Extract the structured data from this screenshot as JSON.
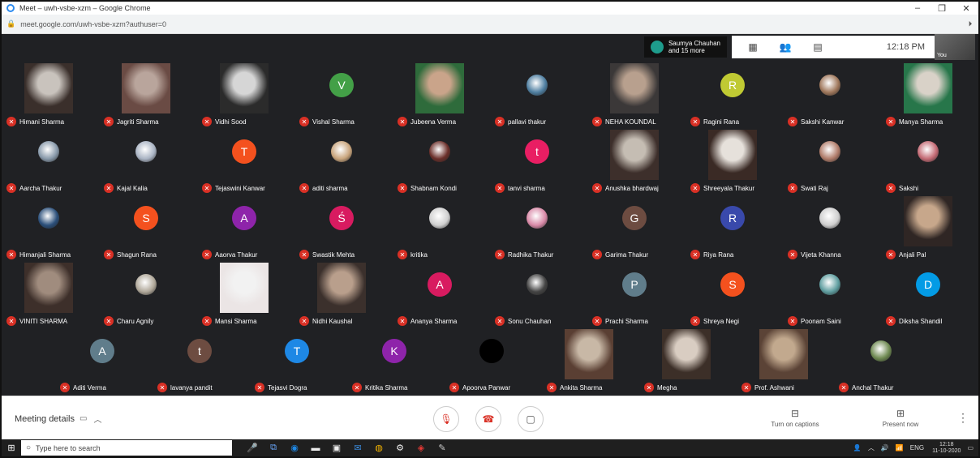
{
  "window": {
    "title": "Meet – uwh-vsbe-xzm – Google Chrome",
    "url": "meet.google.com/uwh-vsbe-xzm?authuser=0"
  },
  "meet": {
    "participants_chip": "Saumya Chauhan\nand 15 more",
    "clock": "12:18 PM",
    "self_label": "You"
  },
  "tiles": [
    [
      {
        "name": "Himani Sharma",
        "kind": "video",
        "colors": [
          "#c9c3bd",
          "#3a2f2b"
        ]
      },
      {
        "name": "Jagriti Sharma",
        "kind": "video",
        "colors": [
          "#b9a59c",
          "#6a4b44"
        ]
      },
      {
        "name": "Vidhi Sood",
        "kind": "video",
        "colors": [
          "#d6d6d6",
          "#2b2b2b"
        ]
      },
      {
        "name": "Vishal Sharma",
        "kind": "avatar",
        "letter": "V",
        "color": "#43a047"
      },
      {
        "name": "Jubeena Verma",
        "kind": "video",
        "colors": [
          "#caa48a",
          "#2e6b3b"
        ]
      },
      {
        "name": "pallavi thakur",
        "kind": "photo",
        "color": "#4f7fa1"
      },
      {
        "name": "NEHA KOUNDAL",
        "kind": "video",
        "colors": [
          "#b8a08e",
          "#3b3838"
        ]
      },
      {
        "name": "Ragini Rana",
        "kind": "avatar",
        "letter": "R",
        "color": "#c0ca33"
      },
      {
        "name": "Sakshi Kanwar",
        "kind": "photo",
        "color": "#a0785c"
      },
      {
        "name": "Manya Sharma",
        "kind": "video",
        "colors": [
          "#d9d2c8",
          "#27764a"
        ]
      }
    ],
    [
      {
        "name": "Aarcha Thakur",
        "kind": "photo",
        "color": "#8899aa"
      },
      {
        "name": "Kajal Kalia",
        "kind": "photo",
        "color": "#aab4c4"
      },
      {
        "name": "Tejaswini Kanwar",
        "kind": "avatar",
        "letter": "T",
        "color": "#f4511e"
      },
      {
        "name": "aditi sharma",
        "kind": "photo",
        "color": "#c9a57d"
      },
      {
        "name": "Shabnam Kondi",
        "kind": "photo",
        "color": "#6b2f2a"
      },
      {
        "name": "tanvi sharma",
        "kind": "avatar",
        "letter": "t",
        "color": "#e91e63"
      },
      {
        "name": "Anushka bhardwaj",
        "kind": "video",
        "colors": [
          "#c5bdb3",
          "#3d2f2b"
        ]
      },
      {
        "name": "Shreeyala Thakur",
        "kind": "video",
        "colors": [
          "#e6e1db",
          "#3a2a25"
        ]
      },
      {
        "name": "Swati Raj",
        "kind": "photo",
        "color": "#b07c6a"
      },
      {
        "name": "Sakshi",
        "kind": "photo",
        "color": "#c46b75"
      }
    ],
    [
      {
        "name": "Himanjali Sharma",
        "kind": "photo",
        "color": "#2b4f7a"
      },
      {
        "name": "Shagun Rana",
        "kind": "avatar",
        "letter": "S",
        "color": "#f4511e"
      },
      {
        "name": "Aaorva Thakur",
        "kind": "avatar",
        "letter": "A",
        "color": "#8e24aa"
      },
      {
        "name": "Swastik Mehta",
        "kind": "avatar",
        "letter": "Ś",
        "color": "#d81b60"
      },
      {
        "name": "kritika",
        "kind": "photo",
        "color": "#d0d0d0"
      },
      {
        "name": "Radhika Thakur",
        "kind": "photo",
        "color": "#d98aa8"
      },
      {
        "name": "Garima Thakur",
        "kind": "avatar",
        "letter": "G",
        "color": "#6d4c41"
      },
      {
        "name": "Riya Rana",
        "kind": "avatar",
        "letter": "R",
        "color": "#3949ab"
      },
      {
        "name": "Vijeta Khanna",
        "kind": "photo",
        "color": "#cfcfcf"
      },
      {
        "name": "Anjali Pal",
        "kind": "video",
        "colors": [
          "#c7a78b",
          "#2f2624"
        ]
      }
    ],
    [
      {
        "name": "VINITI SHARMA",
        "kind": "video",
        "colors": [
          "#a08c7e",
          "#3d2f2a"
        ]
      },
      {
        "name": "Charu Agnily",
        "kind": "photo",
        "color": "#b0a89a"
      },
      {
        "name": "Mansi Sharma",
        "kind": "video",
        "colors": [
          "#f2f2f2",
          "#ebe5e5"
        ]
      },
      {
        "name": "Nidhi Kaushal",
        "kind": "video",
        "colors": [
          "#b99f8c",
          "#3b302c"
        ]
      },
      {
        "name": "Ananya Sharma",
        "kind": "avatar",
        "letter": "A",
        "color": "#d81b60"
      },
      {
        "name": "Sonu Chauhan",
        "kind": "photo",
        "color": "#444444"
      },
      {
        "name": "Prachi Sharma",
        "kind": "avatar",
        "letter": "P",
        "color": "#607d8b"
      },
      {
        "name": "Shreya Negi",
        "kind": "avatar",
        "letter": "S",
        "color": "#f4511e"
      },
      {
        "name": "Poonam Saini",
        "kind": "photo",
        "color": "#5f9ea0"
      },
      {
        "name": "Diksha Shandil",
        "kind": "avatar",
        "letter": "D",
        "color": "#039be5"
      }
    ],
    [
      {
        "name": "Aditi Verma",
        "kind": "avatar",
        "letter": "A",
        "color": "#607d8b"
      },
      {
        "name": "lavanya pandit",
        "kind": "avatar",
        "letter": "t",
        "color": "#6d4c41"
      },
      {
        "name": "Tejasvi Dogra",
        "kind": "avatar",
        "letter": "T",
        "color": "#1e88e5"
      },
      {
        "name": "Kritika Sharma",
        "kind": "avatar",
        "letter": "K",
        "color": "#8e24aa"
      },
      {
        "name": "Apoorva Panwar",
        "kind": "avatar",
        "letter": "",
        "color": "#000000"
      },
      {
        "name": "Ankita Sharma",
        "kind": "video",
        "colors": [
          "#c8b8a6",
          "#5a3f33"
        ]
      },
      {
        "name": "Megha",
        "kind": "video",
        "colors": [
          "#d9cdc2",
          "#3c2f28"
        ]
      },
      {
        "name": "Prof. Ashwani",
        "kind": "video",
        "colors": [
          "#c2a98e",
          "#5b4336"
        ]
      },
      {
        "name": "Anchal Thakur",
        "kind": "photo",
        "color": "#6f8a52"
      }
    ]
  ],
  "controls": {
    "meeting_details": "Meeting details",
    "captions": "Turn on captions",
    "present": "Present now",
    "mic_icon": "mic-off-icon",
    "hangup_icon": "hangup-icon",
    "camera_icon": "camera-icon"
  },
  "taskbar": {
    "search_placeholder": "Type here to search",
    "language": "ENG",
    "time": "12:18",
    "date": "11-10-2020"
  }
}
